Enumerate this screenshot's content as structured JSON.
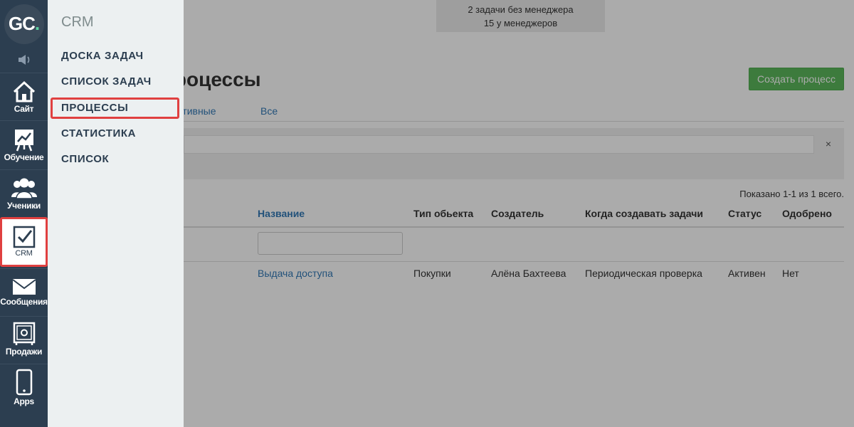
{
  "logo": {
    "text": "GC",
    "dot": "."
  },
  "rail": {
    "items": [
      {
        "label": "Сайт",
        "icon": "home-icon"
      },
      {
        "label": "Обучение",
        "icon": "chart-board-icon"
      },
      {
        "label": "Ученики",
        "icon": "users-icon"
      },
      {
        "label": "CRM",
        "icon": "checkbox-icon"
      },
      {
        "label": "Сообщения",
        "icon": "envelope-icon"
      },
      {
        "label": "Продажи",
        "icon": "safe-icon"
      },
      {
        "label": "Apps",
        "icon": "phone-icon"
      }
    ]
  },
  "panel": {
    "title": "CRM",
    "items": [
      {
        "label": "ДОСКА ЗАДАЧ"
      },
      {
        "label": "СПИСОК ЗАДАЧ"
      },
      {
        "label": "ПРОЦЕССЫ"
      },
      {
        "label": "СТАТИСТИКА"
      },
      {
        "label": "СПИСОК"
      }
    ]
  },
  "notice": {
    "line1": "2 задачи без менеджера",
    "line2": "15 у менеджеров"
  },
  "page": {
    "title_visible": "процессы",
    "create_button": "Создать процесс",
    "tabs": {
      "active_partial": "ктивные",
      "all": "Все"
    },
    "filter_clear": "×",
    "summary": "Показано 1-1 из 1 всего."
  },
  "table": {
    "headers": {
      "name": "Название",
      "object_type": "Тип обьекта",
      "creator": "Создатель",
      "when": "Когда создавать задачи",
      "status": "Статус",
      "approved": "Одобрено"
    },
    "rows": [
      {
        "name": "Выдача доступа",
        "object_type": "Покупки",
        "creator": "Алёна Бахтеева",
        "when": "Периодическая проверка",
        "status": "Активен",
        "approved": "Нет"
      }
    ]
  },
  "colors": {
    "rail_bg": "#2c3e50",
    "panel_bg": "#ecf0f1",
    "highlight": "#e04040",
    "link": "#337ab7",
    "success": "#5cb85c"
  }
}
